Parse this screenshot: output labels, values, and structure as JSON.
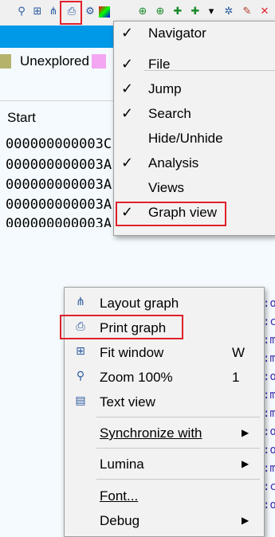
{
  "toolbar": {
    "icons": [
      "zoom-icon",
      "fit-window-icon",
      "layout-graph-icon",
      "print-icon",
      "settings-icon",
      "color-icon",
      "add-node-icon",
      "add-group-icon",
      "add-edge-icon",
      "add-icon",
      "dropdown-icon",
      "star-icon",
      "edit-icon",
      "close-icon"
    ]
  },
  "legend": {
    "unexplored_label": "Unexplored"
  },
  "listing": {
    "column_header": "Start",
    "rows": [
      "000000000003C",
      "000000000003A",
      "000000000003A",
      "000000000003A",
      "000000000003A"
    ]
  },
  "view_menu": {
    "items": [
      {
        "label": "Navigator",
        "checked": true
      },
      {
        "label": "File",
        "checked": true
      },
      {
        "label": "Jump",
        "checked": true
      },
      {
        "label": "Search",
        "checked": true
      },
      {
        "label": "Hide/Unhide",
        "checked": false
      },
      {
        "label": "Analysis",
        "checked": true
      },
      {
        "label": "Views",
        "checked": false
      },
      {
        "label": "Graph view",
        "checked": true
      }
    ]
  },
  "graph_menu": {
    "layout_graph": "Layout graph",
    "print_graph": "Print graph",
    "fit_window": "Fit window",
    "fit_window_shortcut": "W",
    "zoom_100": "Zoom 100%",
    "zoom_100_shortcut": "1",
    "text_view": "Text view",
    "synchronize_with": "Synchronize with",
    "lumina": "Lumina",
    "font": "Font...",
    "debug": "Debug"
  },
  "colors": {
    "highlight": "#e0212b",
    "band": "#0099e8",
    "menu_bg": "#f2f2f2"
  }
}
